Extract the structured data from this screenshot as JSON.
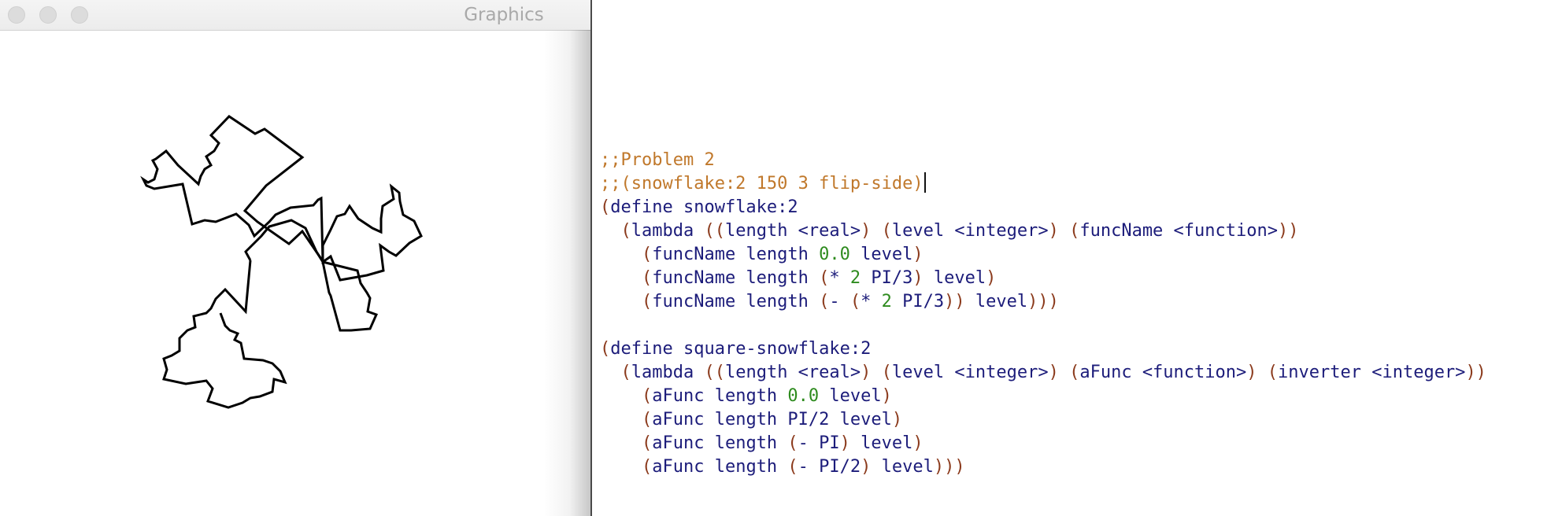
{
  "graphics_window": {
    "title": "Graphics",
    "traffic_lights": [
      "close-button",
      "minimize-button",
      "zoom-button"
    ],
    "stroke_color": "#000000"
  },
  "editor": {
    "colors": {
      "comment": "#c0782b",
      "paren": "#8b3a1c",
      "identifier": "#1c1c7a",
      "number": "#2e8b1e"
    },
    "lines": [
      [
        {
          "t": ";;Problem 2",
          "c": "comment"
        }
      ],
      [
        {
          "t": ";;(snowflake:2 150 3 flip-side)",
          "c": "comment"
        }
      ],
      [
        {
          "t": "(",
          "c": "paren"
        },
        {
          "t": "define snowflake:2",
          "c": "ident"
        }
      ],
      [
        {
          "t": "  ",
          "c": "sp"
        },
        {
          "t": "(",
          "c": "paren"
        },
        {
          "t": "lambda ",
          "c": "ident"
        },
        {
          "t": "((",
          "c": "paren"
        },
        {
          "t": "length <real>",
          "c": "ident"
        },
        {
          "t": ")",
          "c": "paren"
        },
        {
          "t": " ",
          "c": "sp"
        },
        {
          "t": "(",
          "c": "paren"
        },
        {
          "t": "level <integer>",
          "c": "ident"
        },
        {
          "t": ")",
          "c": "paren"
        },
        {
          "t": " ",
          "c": "sp"
        },
        {
          "t": "(",
          "c": "paren"
        },
        {
          "t": "funcName <function>",
          "c": "ident"
        },
        {
          "t": "))",
          "c": "paren"
        }
      ],
      [
        {
          "t": "    ",
          "c": "sp"
        },
        {
          "t": "(",
          "c": "paren"
        },
        {
          "t": "funcName length ",
          "c": "ident"
        },
        {
          "t": "0.0",
          "c": "num"
        },
        {
          "t": " level",
          "c": "ident"
        },
        {
          "t": ")",
          "c": "paren"
        }
      ],
      [
        {
          "t": "    ",
          "c": "sp"
        },
        {
          "t": "(",
          "c": "paren"
        },
        {
          "t": "funcName length ",
          "c": "ident"
        },
        {
          "t": "(",
          "c": "paren"
        },
        {
          "t": "* ",
          "c": "ident"
        },
        {
          "t": "2",
          "c": "num"
        },
        {
          "t": " PI/3",
          "c": "ident"
        },
        {
          "t": ")",
          "c": "paren"
        },
        {
          "t": " level",
          "c": "ident"
        },
        {
          "t": ")",
          "c": "paren"
        }
      ],
      [
        {
          "t": "    ",
          "c": "sp"
        },
        {
          "t": "(",
          "c": "paren"
        },
        {
          "t": "funcName length ",
          "c": "ident"
        },
        {
          "t": "(",
          "c": "paren"
        },
        {
          "t": "- ",
          "c": "ident"
        },
        {
          "t": "(",
          "c": "paren"
        },
        {
          "t": "* ",
          "c": "ident"
        },
        {
          "t": "2",
          "c": "num"
        },
        {
          "t": " PI/3",
          "c": "ident"
        },
        {
          "t": "))",
          "c": "paren"
        },
        {
          "t": " level",
          "c": "ident"
        },
        {
          "t": ")))",
          "c": "paren"
        }
      ],
      [],
      [
        {
          "t": "(",
          "c": "paren"
        },
        {
          "t": "define square-snowflake:2",
          "c": "ident"
        }
      ],
      [
        {
          "t": "  ",
          "c": "sp"
        },
        {
          "t": "(",
          "c": "paren"
        },
        {
          "t": "lambda ",
          "c": "ident"
        },
        {
          "t": "((",
          "c": "paren"
        },
        {
          "t": "length <real>",
          "c": "ident"
        },
        {
          "t": ")",
          "c": "paren"
        },
        {
          "t": " ",
          "c": "sp"
        },
        {
          "t": "(",
          "c": "paren"
        },
        {
          "t": "level <integer>",
          "c": "ident"
        },
        {
          "t": ")",
          "c": "paren"
        },
        {
          "t": " ",
          "c": "sp"
        },
        {
          "t": "(",
          "c": "paren"
        },
        {
          "t": "aFunc <function>",
          "c": "ident"
        },
        {
          "t": ")",
          "c": "paren"
        },
        {
          "t": " ",
          "c": "sp"
        },
        {
          "t": "(",
          "c": "paren"
        },
        {
          "t": "inverter <integer>",
          "c": "ident"
        },
        {
          "t": "))",
          "c": "paren"
        }
      ],
      [
        {
          "t": "    ",
          "c": "sp"
        },
        {
          "t": "(",
          "c": "paren"
        },
        {
          "t": "aFunc length ",
          "c": "ident"
        },
        {
          "t": "0.0",
          "c": "num"
        },
        {
          "t": " level",
          "c": "ident"
        },
        {
          "t": ")",
          "c": "paren"
        }
      ],
      [
        {
          "t": "    ",
          "c": "sp"
        },
        {
          "t": "(",
          "c": "paren"
        },
        {
          "t": "aFunc length PI/2 level",
          "c": "ident"
        },
        {
          "t": ")",
          "c": "paren"
        }
      ],
      [
        {
          "t": "    ",
          "c": "sp"
        },
        {
          "t": "(",
          "c": "paren"
        },
        {
          "t": "aFunc length ",
          "c": "ident"
        },
        {
          "t": "(",
          "c": "paren"
        },
        {
          "t": "- PI",
          "c": "ident"
        },
        {
          "t": ")",
          "c": "paren"
        },
        {
          "t": " level",
          "c": "ident"
        },
        {
          "t": ")",
          "c": "paren"
        }
      ],
      [
        {
          "t": "    ",
          "c": "sp"
        },
        {
          "t": "(",
          "c": "paren"
        },
        {
          "t": "aFunc length ",
          "c": "ident"
        },
        {
          "t": "(",
          "c": "paren"
        },
        {
          "t": "- PI/2",
          "c": "ident"
        },
        {
          "t": ")",
          "c": "paren"
        },
        {
          "t": " level",
          "c": "ident"
        },
        {
          "t": ")))",
          "c": "paren"
        }
      ]
    ],
    "caret_line": 1
  }
}
